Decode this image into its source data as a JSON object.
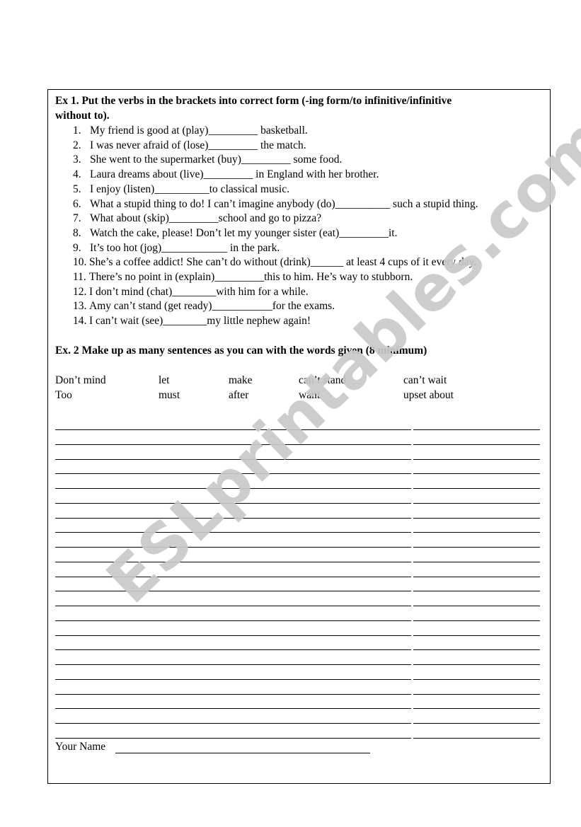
{
  "exercise1": {
    "title_line1": "Ex 1. Put the verbs in the brackets into correct  form (-ing form/to infinitive/infinitive",
    "title_line2": "without to).",
    "items": [
      {
        "num": "1.",
        "text": "My friend is good at (play)_________ basketball."
      },
      {
        "num": "2.",
        "text": "I was never afraid of (lose)_________ the match."
      },
      {
        "num": "3.",
        "text": "She went to the supermarket (buy)_________ some food."
      },
      {
        "num": "4.",
        "text": "Laura dreams about (live)_________ in England with her brother."
      },
      {
        "num": "5.",
        "text": "I enjoy (listen)__________to classical music."
      },
      {
        "num": "6.",
        "text": "What a stupid thing to do! I can’t imagine anybody (do)__________ such a stupid thing."
      },
      {
        "num": "7.",
        "text": "What about (skip)_________school and go to pizza?"
      },
      {
        "num": "8.",
        "text": "Watch the cake, please! Don’t let my younger sister (eat)_________it."
      },
      {
        "num": "9.",
        "text": "It’s too hot (jog)____________ in the park."
      },
      {
        "num": "10.",
        "text": "She’s a coffee addict! She can’t do without (drink)______ at least 4 cups of it every day."
      },
      {
        "num": "11.",
        "text": "There’s no point in (explain)_________this to him. He’s way to stubborn."
      },
      {
        "num": "12.",
        "text": "I don’t mind (chat)________with him for a while."
      },
      {
        "num": "13.",
        "text": "Amy can’t stand (get ready)___________for the exams."
      },
      {
        "num": "14.",
        "text": "I can’t wait (see)________my little nephew again!"
      }
    ]
  },
  "exercise2": {
    "title": "Ex. 2 Make up as many sentences as you can with the words given (8 minimum)",
    "word_rows": [
      [
        "Don’t mind",
        "let",
        "make",
        "can’t stand",
        "can’t wait"
      ],
      [
        "Too",
        "must",
        "after",
        "want",
        "upset about"
      ]
    ],
    "writing_lines_count": 22
  },
  "footer": {
    "name_label": "Your Name"
  },
  "watermark": {
    "text": "ESLprintables.com",
    "color": "#c9c9c9"
  }
}
